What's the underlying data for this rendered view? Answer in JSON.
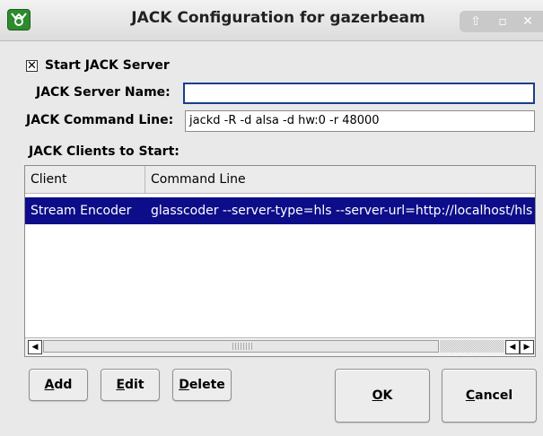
{
  "window": {
    "title": "JACK Configuration for gazerbeam",
    "controls": [
      "up-arrow-icon",
      "maximize-icon",
      "close-icon"
    ]
  },
  "start_server": {
    "checked": true,
    "label": "Start JACK Server"
  },
  "server_name": {
    "label": "JACK Server Name:",
    "value": ""
  },
  "command_line": {
    "label": "JACK Command Line:",
    "value": "jackd -R -d alsa -d hw:0 -r 48000"
  },
  "clients": {
    "label": "JACK Clients to Start:",
    "columns": [
      "Client",
      "Command Line"
    ],
    "rows": [
      {
        "client": "Stream Encoder",
        "command": "glasscoder --server-type=hls --server-url=http://localhost/hls"
      }
    ]
  },
  "buttons": {
    "add": {
      "accel": "A",
      "rest": "dd"
    },
    "edit": {
      "accel": "E",
      "rest": "dit"
    },
    "delete": {
      "accel": "D",
      "rest": "elete"
    },
    "ok": {
      "accel": "O",
      "rest": "K"
    },
    "cancel": {
      "accel": "C",
      "rest": "ancel"
    }
  },
  "colors": {
    "selection": "#0d0d8a",
    "focus_border": "#1a3d8f",
    "app_icon": "#2e8b2e"
  }
}
